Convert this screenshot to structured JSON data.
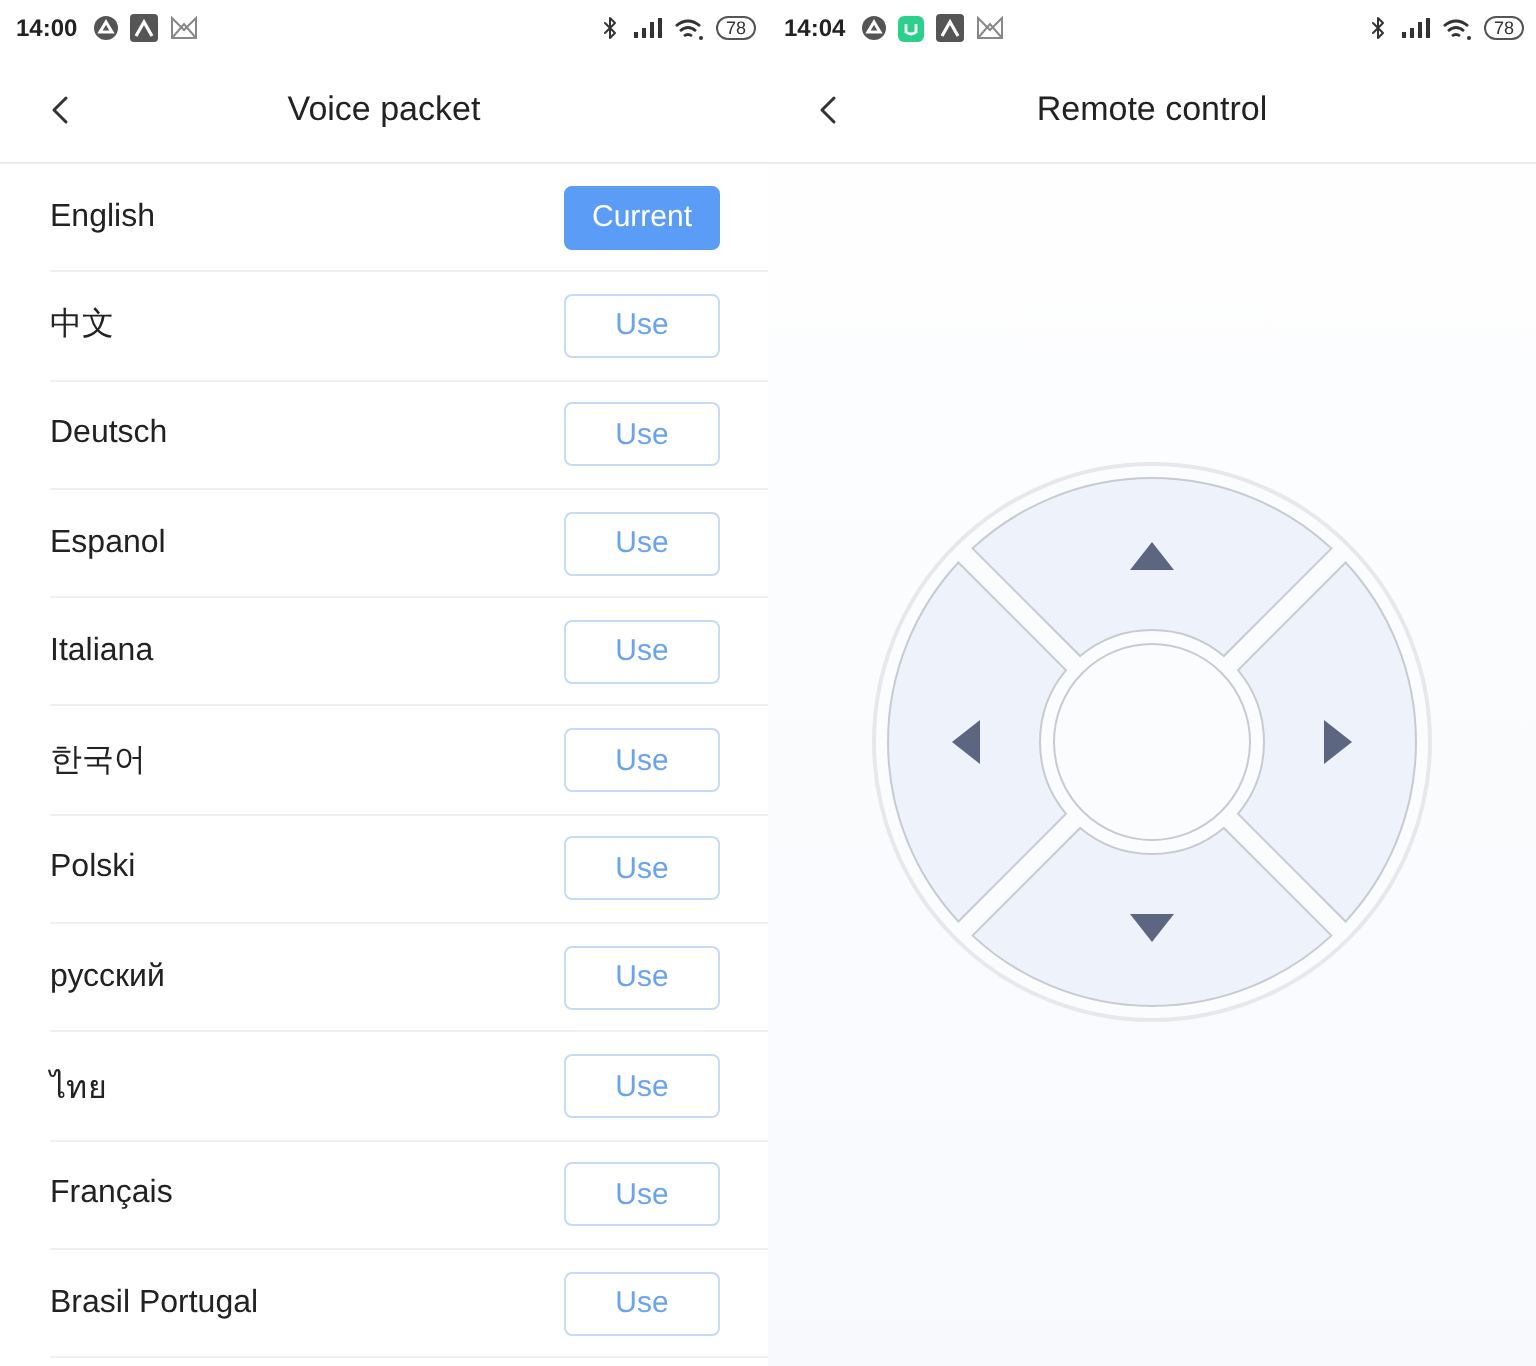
{
  "voice_screen": {
    "status_bar": {
      "time": "14:00",
      "notifications": [
        {
          "kind": "round"
        },
        {
          "kind": "square"
        },
        {
          "kind": "mail"
        }
      ],
      "battery": "78"
    },
    "title": "Voice packet",
    "languages": [
      {
        "name": "English",
        "button": "Current",
        "selected": true
      },
      {
        "name": "中文",
        "button": "Use",
        "selected": false
      },
      {
        "name": "Deutsch",
        "button": "Use",
        "selected": false
      },
      {
        "name": "Espanol",
        "button": "Use",
        "selected": false
      },
      {
        "name": "Italiana",
        "button": "Use",
        "selected": false
      },
      {
        "name": "한국어",
        "button": "Use",
        "selected": false
      },
      {
        "name": "Polski",
        "button": "Use",
        "selected": false
      },
      {
        "name": "русский",
        "button": "Use",
        "selected": false
      },
      {
        "name": "ไทย",
        "button": "Use",
        "selected": false
      },
      {
        "name": "Français",
        "button": "Use",
        "selected": false
      },
      {
        "name": "Brasil Portugal",
        "button": "Use",
        "selected": false
      }
    ]
  },
  "remote_screen": {
    "status_bar": {
      "time": "14:04",
      "notifications": [
        {
          "kind": "round"
        },
        {
          "kind": "green"
        },
        {
          "kind": "square"
        },
        {
          "kind": "mail"
        }
      ],
      "battery": "78"
    },
    "title": "Remote control"
  }
}
